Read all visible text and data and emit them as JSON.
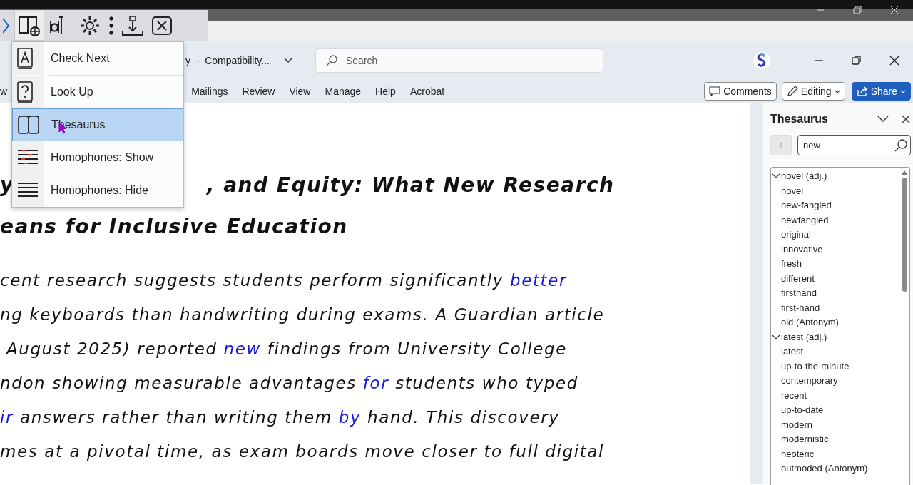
{
  "floating_toolbar": {
    "items": [
      {
        "kind": "partial",
        "selected": false
      },
      {
        "kind": "book-globe",
        "selected": true
      },
      {
        "kind": "text-cursor",
        "selected": false
      },
      {
        "kind": "gear",
        "selected": false
      },
      {
        "kind": "more",
        "selected": false
      },
      {
        "kind": "download",
        "selected": false
      },
      {
        "kind": "close",
        "selected": false
      }
    ]
  },
  "title_bar": {
    "document_title": "y  -  Compatibility...",
    "search_placeholder": "Search"
  },
  "ribbon": {
    "partial_tab": "w",
    "tabs": [
      "Mailings",
      "Review",
      "View",
      "Manage",
      "Help",
      "Acrobat"
    ],
    "comments": "Comments",
    "editing": "Editing",
    "share": "Share"
  },
  "menu": {
    "items": [
      {
        "kind": "check-next",
        "label": "Check Next",
        "selected": false
      },
      {
        "kind": "look-up",
        "label": "Look Up",
        "selected": false
      },
      {
        "kind": "thesaurus",
        "label": "Thesaurus",
        "selected": true
      },
      {
        "kind": "homophones-show",
        "label": "Homophones: Show",
        "selected": false
      },
      {
        "kind": "homophones-hide",
        "label": "Homophones: Hide",
        "selected": false
      }
    ]
  },
  "document": {
    "title_lines": [
      [
        "y",
        ", and Equity: What New Research"
      ],
      [
        "eans for Inclusive Education"
      ]
    ],
    "paragraph_lines": [
      [
        {
          "text": "cent research suggests students perform significantly ",
          "flagged": false
        },
        {
          "text": "better",
          "flagged": true
        }
      ],
      [
        {
          "text": "ng keyboards than handwriting during exams. A Guardian article",
          "flagged": false
        }
      ],
      [
        {
          "text": " August 2025) reported ",
          "flagged": false
        },
        {
          "text": "new",
          "flagged": true
        },
        {
          "text": " findings from University College",
          "flagged": false
        }
      ],
      [
        {
          "text": "ndon showing measurable advantages ",
          "flagged": false
        },
        {
          "text": "for",
          "flagged": true
        },
        {
          "text": " students who typed",
          "flagged": false
        }
      ],
      [
        {
          "text": "ir",
          "flagged": true
        },
        {
          "text": " answers rather than writing them ",
          "flagged": false
        },
        {
          "text": "by",
          "flagged": true
        },
        {
          "text": " hand. This discovery",
          "flagged": false
        }
      ],
      [
        {
          "text": "mes at a pivotal time, as exam boards move closer to full digital",
          "flagged": false
        }
      ]
    ]
  },
  "thesaurus_pane": {
    "title": "Thesaurus",
    "search_value": "new",
    "groups": [
      {
        "label": "novel (adj.)",
        "expanded": true,
        "children": [
          "novel",
          "new-fangled",
          "newfangled",
          "original",
          "innovative",
          "fresh",
          "different",
          "firsthand",
          "first-hand",
          "old (Antonym)"
        ]
      },
      {
        "label": "latest (adj.)",
        "expanded": true,
        "children": [
          "latest",
          "up-to-the-minute",
          "contemporary",
          "recent",
          "up-to-date",
          "modern",
          "modernistic",
          "neoteric",
          "outmoded (Antonym)"
        ]
      }
    ]
  }
}
